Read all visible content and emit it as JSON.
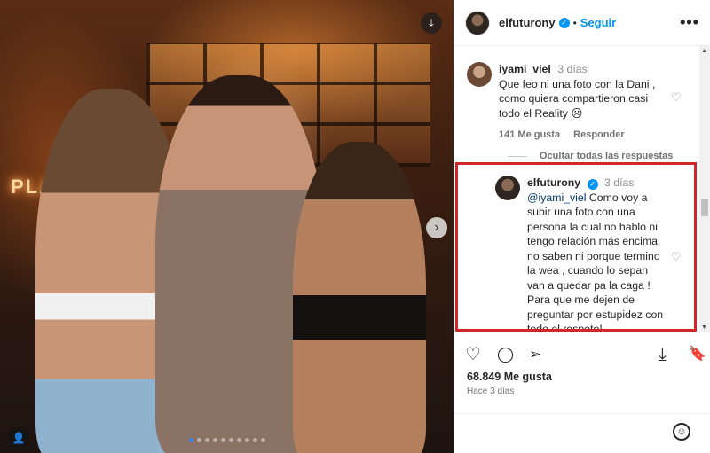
{
  "post": {
    "next_glyph": "›",
    "download_glyph": "⤓",
    "user_glyph": "👤",
    "neon_text": "PLAY",
    "carousel": {
      "count": 10,
      "active": 0
    }
  },
  "header": {
    "username": "elfuturony",
    "verified_glyph": "✓",
    "separator": "•",
    "follow_label": "Seguir",
    "more_glyph": "•••"
  },
  "comments": [
    {
      "username": "iyami_viel",
      "time": "3 días",
      "text": "Que feo ni una foto con la Dani , como quiera compartieron casi todo el Reality ☹",
      "likes": "141 Me gusta",
      "reply_label": "Responder"
    },
    {
      "username": "elfuturony",
      "time": "3 días",
      "mention": "@iyami_viel",
      "text": " Como voy a subir una foto con una persona la cual no hablo ni tengo relación más encima no saben ni porque termino la wea , cuando lo sepan van a quedar pa la caga ! Para que me dejen de preguntar por estupidez con todo el respeto!"
    }
  ],
  "hide_replies_label": "Ocultar todas las respuestas",
  "heart_glyph": "♡",
  "actions": {
    "like_glyph": "♡",
    "comment_glyph": "◯",
    "share_glyph": "➢",
    "download_glyph": "⤓",
    "save_glyph": "🔖"
  },
  "likes_total": "68.849 Me gusta",
  "time_ago": "Hace 3 días",
  "emoji_glyph": "☺",
  "colors": {
    "accent": "#0095f6",
    "highlight": "#d42626"
  }
}
